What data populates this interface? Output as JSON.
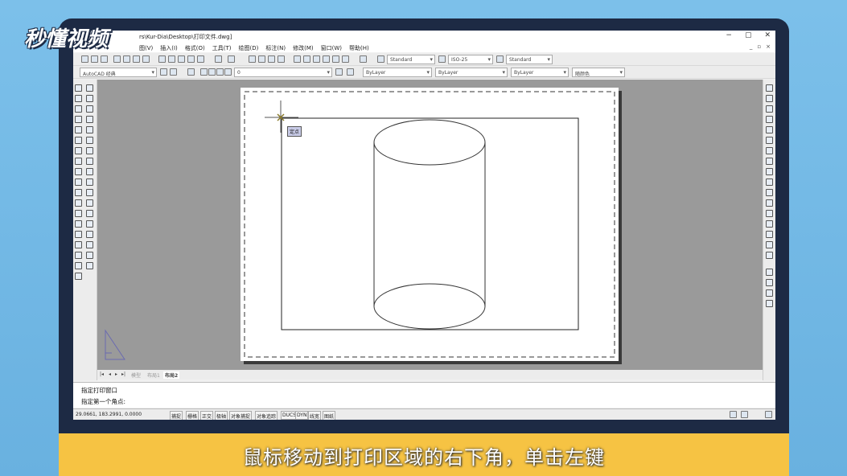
{
  "logo": "秒懂视频",
  "caption": "鼠标移动到打印区域的右下角，单击左键",
  "window": {
    "title": "rs\\Kur-Dia\\Desktop\\打印文件.dwg]",
    "min": "−",
    "max": "▢",
    "close": "✕"
  },
  "menu": {
    "items": [
      "图(V)",
      "插入(I)",
      "格式(O)",
      "工具(T)",
      "绘图(D)",
      "标注(N)",
      "修改(M)",
      "窗口(W)",
      "帮助(H)"
    ],
    "mdi": [
      "_",
      "▫",
      "×"
    ]
  },
  "toolbar": {
    "text_style": "Standard",
    "dim_style": "ISO-25",
    "table_style": "Standard",
    "workspace": "AutoCAD 经典",
    "layer": "0",
    "color": "ByLayer",
    "linetype": "ByLayer",
    "lineweight": "ByLayer",
    "plotstyle": "随颜色"
  },
  "drawing": {
    "tooltip": "定点",
    "tabs": [
      "模型",
      "布局1",
      "布局2"
    ]
  },
  "command": {
    "line1": "指定打印窗口",
    "line2": "指定第一个角点:"
  },
  "status": {
    "coords": "29.0661,  183.2991, 0.0000",
    "modes": [
      "捕捉",
      "栅格",
      "正交",
      "极轴",
      "对象捕捉",
      "对象追踪",
      "DUCS",
      "DYN",
      "线宽",
      "图纸"
    ]
  },
  "colors": {
    "caption_bg": "#f6c343",
    "monitor": "#1d2a44",
    "background": "#6db3e0"
  }
}
